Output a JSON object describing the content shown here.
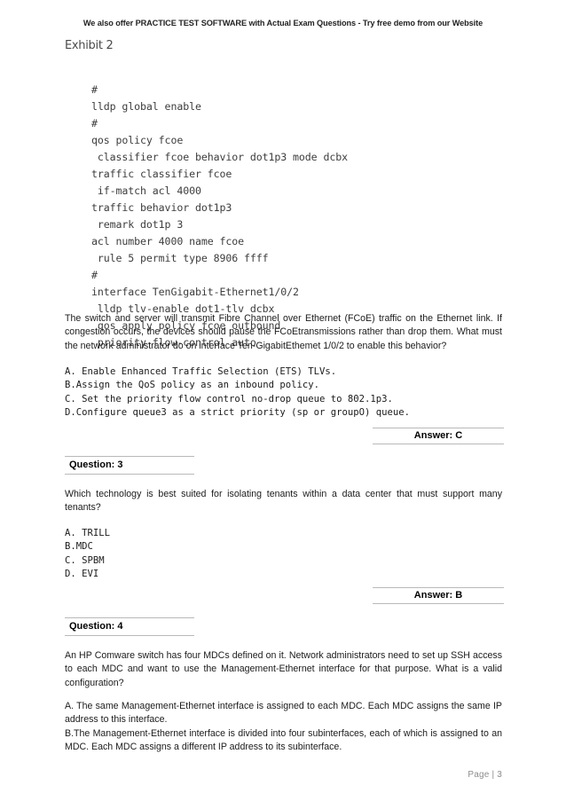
{
  "header": {
    "promo": "We also offer PRACTICE TEST SOFTWARE with Actual Exam Questions - Try free demo from our Website"
  },
  "exhibit": {
    "caption": "Exhibit 2"
  },
  "code_block": {
    "lines": [
      "#",
      "lldp global enable",
      "#",
      "qos policy fcoe",
      " classifier fcoe behavior dot1p3 mode dcbx",
      "traffic classifier fcoe",
      " if-match acl 4000",
      "traffic behavior dot1p3",
      " remark dot1p 3",
      "acl number 4000 name fcoe",
      " rule 5 permit type 8906 ffff",
      "#",
      "interface TenGigabit-Ethernet1/0/2",
      " lldp tlv-enable dot1-tlv dcbx",
      " qos apply policy fcoe outbound",
      " priority-flow-control auto"
    ],
    "text": "#\nlldp global enable\n#\nqos policy fcoe\n classifier fcoe behavior dot1p3 mode dcbx\ntraffic classifier fcoe\n if-match acl 4000\ntraffic behavior dot1p3\n remark dot1p 3\nacl number 4000 name fcoe\n rule 5 permit type 8906 ffff\n#\ninterface TenGigabit-Ethernet1/0/2\n lldp tlv-enable dot1-tlv dcbx\n qos apply policy fcoe outbound\n priority-flow-control auto"
  },
  "question_2": {
    "stem": "The switch and server will transmit Fibre Channel over Ethernet (FCoE) traffic on the Ethernet link. If congestion occurs, the devices should pause the FCoEtransmissions rather than drop them. What must the network administrator do on interface Ten-GigabitEthemet 1/0/2 to enable this behavior?",
    "options": [
      "A. Enable Enhanced Traffic Selection (ETS) TLVs.",
      "B.Assign the QoS policy as an inbound policy.",
      "C. Set the priority flow control no-drop queue to 802.1p3.",
      "D.Configure queue3 as a strict priority (sp or groupO) queue."
    ],
    "options_text": "A. Enable Enhanced Traffic Selection (ETS) TLVs.\nB.Assign the QoS policy as an inbound policy.\nC. Set the priority flow control no-drop queue to 802.1p3.\nD.Configure queue3 as a strict priority (sp or groupO) queue.",
    "answer": "Answer: C"
  },
  "question_3": {
    "heading": "Question: 3",
    "stem": "Which technology is best suited for isolating tenants within a data center that must support many tenants?",
    "options": [
      "A. TRILL",
      "B.MDC",
      "C. SPBM",
      "D. EVI"
    ],
    "options_text": "A. TRILL\nB.MDC\nC. SPBM\nD. EVI",
    "answer": "Answer: B"
  },
  "question_4": {
    "heading": "Question: 4",
    "stem": "An HP Comware switch has four MDCs defined on it. Network administrators need to set up SSH access to each MDC and want to use the Management-Ethernet interface for that purpose. What is a valid configuration?",
    "options": [
      "A. The same Management-Ethernet interface is assigned to each MDC. Each MDC assigns the same IP address to this interface.",
      "B.The Management-Ethernet interface is divided into four subinterfaces, each of which is assigned to an MDC. Each MDC assigns a different IP address to its subinterface."
    ],
    "option_a": "A. The same Management-Ethernet interface is assigned to each MDC. Each MDC assigns the same IP address to this interface.",
    "option_b": "B.The Management-Ethernet interface is divided into four subinterfaces, each of which is assigned to an MDC. Each MDC assigns a different IP address to its subinterface."
  },
  "footer": {
    "page_label": "Page | 3"
  }
}
